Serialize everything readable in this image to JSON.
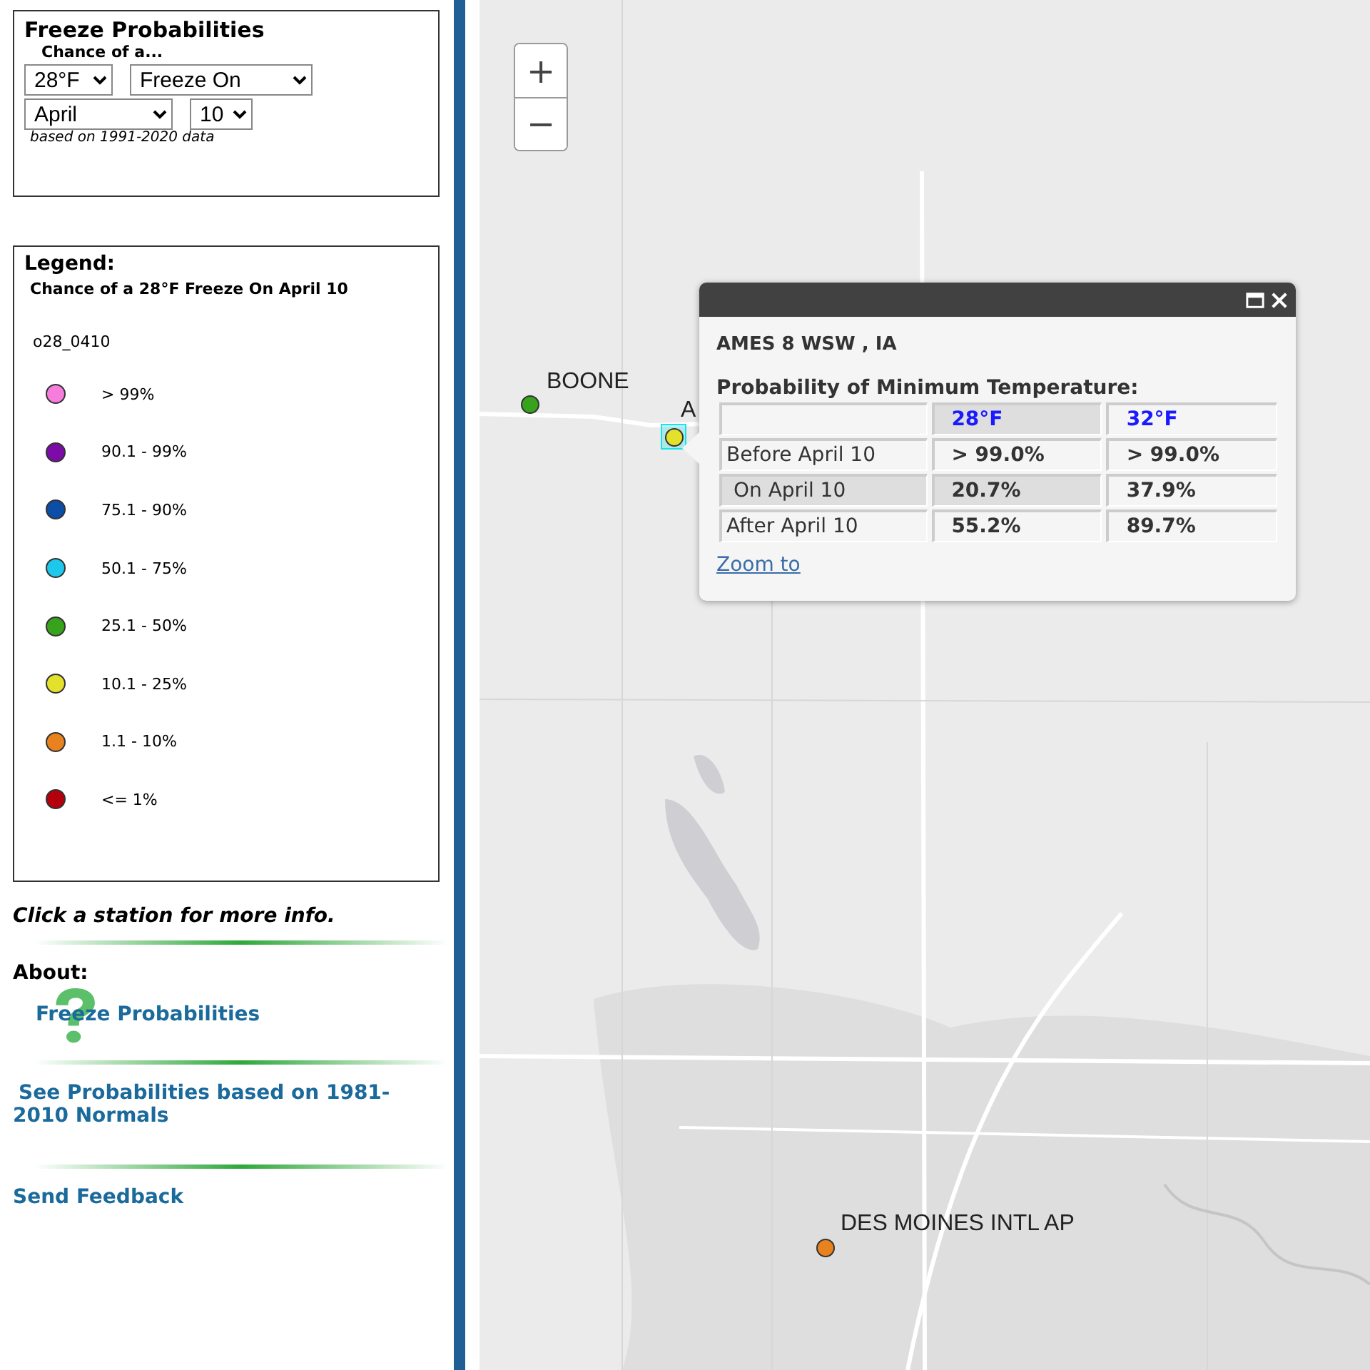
{
  "controls": {
    "title": "Freeze Probabilities",
    "subtitle": "Chance of a...",
    "selects": [
      {
        "value": "28°F"
      },
      {
        "value": "Freeze On"
      },
      {
        "value": "April"
      },
      {
        "value": "10"
      }
    ],
    "note": "based on 1991-2020 data"
  },
  "legend": {
    "title": "Legend:",
    "subtitle": "Chance of a 28°F Freeze On April 10",
    "layer": "o28_0410",
    "items": [
      {
        "label": "> 99%",
        "color": "#f77ddc"
      },
      {
        "label": "90.1 - 99%",
        "color": "#7d0ba8"
      },
      {
        "label": "75.1 - 90%",
        "color": "#0a4ea8"
      },
      {
        "label": "50.1 - 75%",
        "color": "#1ec8ea"
      },
      {
        "label": "25.1 - 50%",
        "color": "#37a31c"
      },
      {
        "label": "10.1 - 25%",
        "color": "#e3e12b"
      },
      {
        "label": "1.1 - 10%",
        "color": "#e8821e"
      },
      {
        "label": "<= 1%",
        "color": "#b4000c"
      }
    ]
  },
  "hint": "Click a station for more info.",
  "about": {
    "title": "About:",
    "logo_link": "Freeze Probabilities",
    "normals_link": "See Probabilities based on 1981-2010 Normals",
    "feedback_link": "Send Feedback"
  },
  "map": {
    "zoom_in": "+",
    "zoom_out": "−",
    "stations": [
      {
        "label": "BOONE",
        "color": "#37a31c",
        "selected": false
      },
      {
        "label": "A",
        "color": "#e3e12b",
        "selected": true
      },
      {
        "label": "DES MOINES INTL AP",
        "color": "#e8821e",
        "selected": false
      }
    ],
    "popup": {
      "station": "AMES 8 WSW , IA",
      "heading": "Probability of Minimum Temperature:",
      "columns": [
        {
          "label": "28°F",
          "selected": true
        },
        {
          "label": "32°F",
          "selected": false
        }
      ],
      "rows": [
        {
          "label": "Before April 10",
          "selected": false,
          "values": [
            "> 99.0%",
            "> 99.0%"
          ]
        },
        {
          "label": "On April 10",
          "selected": true,
          "values": [
            "20.7%",
            "37.9%"
          ]
        },
        {
          "label": "After April 10",
          "selected": false,
          "values": [
            "55.2%",
            "89.7%"
          ]
        }
      ],
      "link": "Zoom to"
    }
  }
}
